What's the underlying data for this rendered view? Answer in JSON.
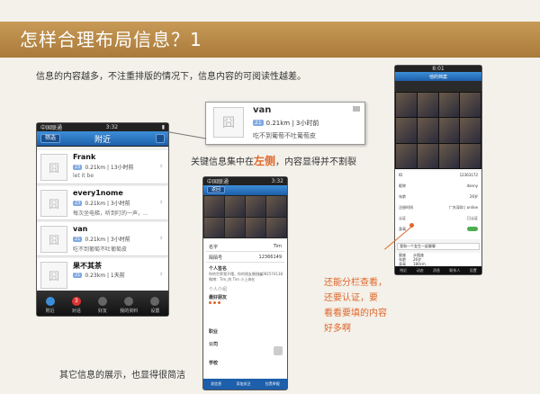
{
  "header": {
    "title": "怎样合理布局信息？1"
  },
  "intro": "信息的内容越多，不注重排版的情况下，信息内容的可阅读性越差。",
  "callout": {
    "pre": "关键信息集中在",
    "emph": "左侧",
    "post": "，内容显得并不割裂"
  },
  "bottom_caption": "其它信息的展示，也显得很简洁",
  "right_caption": [
    "还能分栏查看，",
    "还要认证，要",
    "看看要填的内容",
    "好多啊"
  ],
  "zoom": {
    "name": "van",
    "age": "21",
    "distance": "0.21km | 3小时前",
    "message": "吃不到葡萄不吐葡萄皮"
  },
  "phone1": {
    "carrier": "中国联通",
    "time": "3:32",
    "title": "附近",
    "left_btn": "筛选",
    "rows": [
      {
        "name": "Frank",
        "age": "23",
        "distance": "0.21km | 13小时前",
        "message": "let it be"
      },
      {
        "name": "every1nome",
        "age": "23",
        "distance": "0.21km | 3小时前",
        "message": "每次坐电梯，听到叮的一声，..."
      },
      {
        "name": "van",
        "age": "21",
        "distance": "0.21km | 3小时前",
        "message": "吃不到葡萄不吐葡萄皮"
      },
      {
        "name": "果不其茶",
        "age": "21",
        "distance": "0.23km | 1天前",
        "message": ""
      }
    ],
    "tabs": [
      "附近",
      "对话",
      "好友",
      "我的资料",
      "设置"
    ],
    "tab_badge": "3"
  },
  "phone2": {
    "carrier": "中国联通",
    "time": "3:32",
    "nav_btn": "返回",
    "name_label": "名字",
    "name_value": "Tim",
    "id_label": "陌陌号",
    "id_value": "12366149",
    "sig_label": "个人签名",
    "sig_text": [
      "你的世界我不懂，你的朋友圈很大",
      "微博：Tim_的 Tim 小上海在"
    ],
    "sig_id": "rg092574138",
    "sections": [
      "个人介绍",
      "最好朋友",
      "职业",
      "公司",
      "学校"
    ],
    "actions": [
      "发信息",
      "添加关注",
      "拉黑举报"
    ]
  },
  "phone3": {
    "time": "8:01",
    "title": "他的档案",
    "back": "◀",
    "fields": [
      {
        "label": "ID",
        "value": "12363172"
      },
      {
        "label": "昵称",
        "value": "danny"
      },
      {
        "label": "年龄",
        "value": "26岁"
      },
      {
        "label": "注册时间",
        "value": "广东深圳 | online"
      },
      {
        "label": "认证",
        "value": "已认证"
      },
      {
        "label": "身高",
        "value": ""
      }
    ],
    "note": "我和一个女生一起聊聊",
    "rows2": [
      {
        "label": "星座",
        "value": "水瓶座"
      },
      {
        "label": "年龄",
        "value": "26岁"
      },
      {
        "label": "身高",
        "value": "180cm"
      }
    ],
    "tabs": [
      "附近",
      "动态",
      "消息",
      "联系人",
      "设置"
    ]
  },
  "colors": {
    "accent": "#e0662a",
    "header": "#b5864a",
    "nav": "#2c74c2"
  }
}
